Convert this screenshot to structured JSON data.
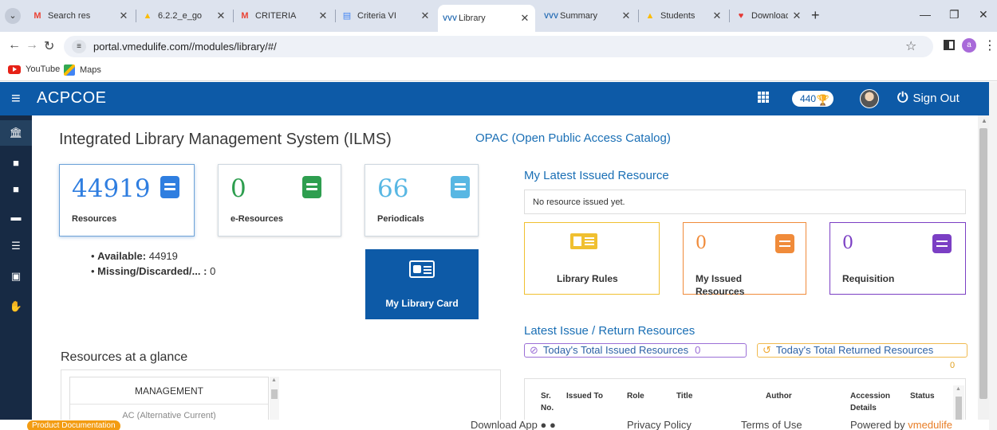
{
  "browser": {
    "tabs": [
      {
        "title": "Search res",
        "icon": "gmail-icon"
      },
      {
        "title": "6.2.2_e_go",
        "icon": "drive-icon"
      },
      {
        "title": "CRITERIA",
        "icon": "gmail-icon"
      },
      {
        "title": "Criteria VI",
        "icon": "docs-icon"
      },
      {
        "title": "Library",
        "icon": "vmedulife-icon",
        "active": true
      },
      {
        "title": "Summary",
        "icon": "vmedulife-icon"
      },
      {
        "title": "Students",
        "icon": "drive-icon"
      },
      {
        "title": "Download",
        "icon": "heart-icon"
      }
    ],
    "url": "portal.vmedulife.com//modules/library/#/",
    "profile_initial": "a",
    "bookmarks": [
      "YouTube",
      "Maps"
    ]
  },
  "header": {
    "brand": "ACPCOE",
    "points": "440",
    "sign_out": "Sign Out"
  },
  "page": {
    "title": "Integrated Library Management System (ILMS)",
    "opac_link": "OPAC (Open Public Access Catalog)"
  },
  "stats": [
    {
      "value": "44919",
      "label": "Resources",
      "color": "#2f7ee0"
    },
    {
      "value": "0",
      "label": "e-Resources",
      "color": "#2e9e4f"
    },
    {
      "value": "66",
      "label": "Periodicals",
      "color": "#58b7e3"
    }
  ],
  "availability": {
    "available_label": "Available:",
    "available_value": "44919",
    "missing_label": "Missing/Discarded/... :",
    "missing_value": "0"
  },
  "library_card": {
    "label": "My Library Card"
  },
  "glance": {
    "title": "Resources at a glance",
    "items": [
      "MANAGEMENT",
      "AC (Alternative Current)"
    ]
  },
  "latest_issued": {
    "title": "My Latest Issued Resource",
    "empty_text": "No resource issued yet."
  },
  "resource_cards": {
    "rules": {
      "label": "Library Rules",
      "color": "#f0c030"
    },
    "issued": {
      "value": "0",
      "label_line1": "My Issued",
      "label_line2": "Resources",
      "color": "#f08b3a"
    },
    "requisition": {
      "value": "0",
      "label": "Requisition",
      "color": "#7b3fc4"
    }
  },
  "issue_return": {
    "title": "Latest Issue / Return Resources",
    "issued_label": "Today's Total Issued Resources",
    "issued_count": "0",
    "returned_label": "Today's Total Returned Resources",
    "returned_count": "0"
  },
  "table": {
    "headers": {
      "sr_1": "Sr.",
      "sr_2": "No.",
      "issued_to": "Issued To",
      "role": "Role",
      "title": "Title",
      "author": "Author",
      "accession_1": "Accession",
      "accession_2": "Details",
      "status": "Status"
    }
  },
  "footer": {
    "product_doc": "Product Documentation",
    "download_app": "Download App",
    "privacy": "Privacy Policy",
    "terms": "Terms of Use",
    "powered_by": "Powered by",
    "powered_brand": "vmedulife"
  }
}
